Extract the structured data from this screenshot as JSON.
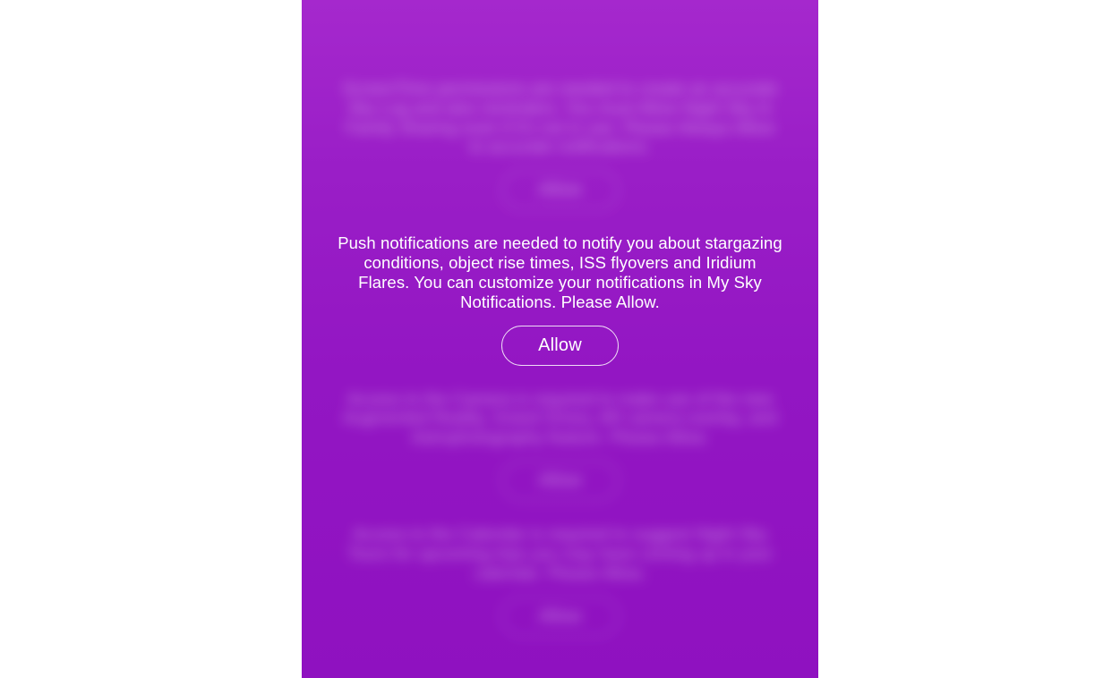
{
  "permissions": {
    "screentime": {
      "text": "ScreenTime permissions are needed to create an accurate Sky Log and also reminders. You must Allow Night Sky in Family Sharing even if it's not in use. Please Always Allow to accurate notifications.",
      "button": "Allow"
    },
    "notifications": {
      "text": "Push notifications are needed to notify you about stargazing conditions, object rise times, ISS flyovers and Iridium Flares. You can customize your notifications in My Sky Notifications. Please Allow.",
      "button": "Allow"
    },
    "camera": {
      "text": "Access to the Camera is required to make use of the new Augmented Reality, Grand Orrery, AR camera overlay, and Astrophotography feature. Please Allow.",
      "button": "Allow"
    },
    "calendar": {
      "text": "Access to the Calendar is required to suggest Night Sky Tours for upcoming trips you may have coming up in your calendar. Please Allow.",
      "button": "Allow"
    }
  }
}
